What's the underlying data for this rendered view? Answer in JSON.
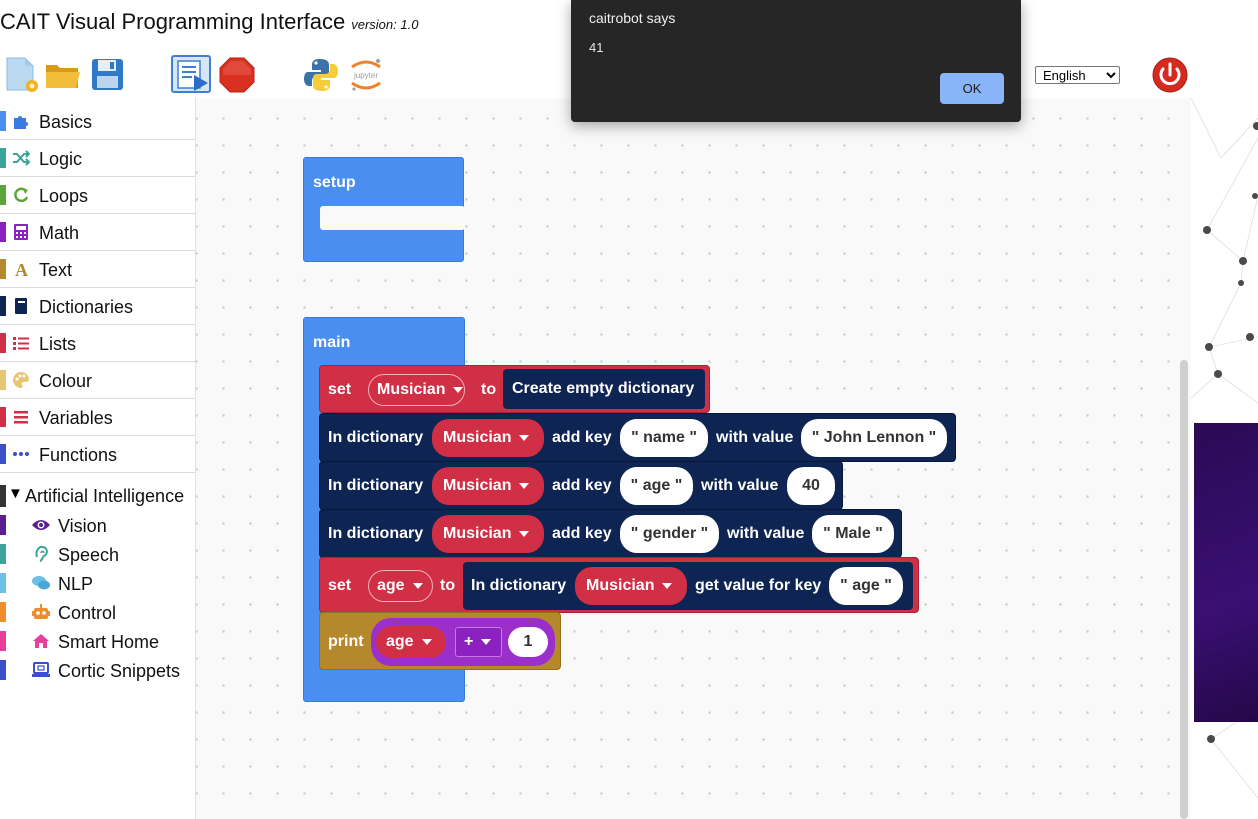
{
  "app": {
    "title": "CAIT Visual Programming Interface",
    "version": "version: 1.0"
  },
  "toolbar": {
    "buttons": [
      "new-file-icon",
      "open-folder-icon",
      "save-icon",
      "run-icon",
      "stop-icon",
      "python-icon",
      "jupyter-icon",
      "power-icon"
    ],
    "jupyter_text": "jupyter",
    "language": "English"
  },
  "sidebar": {
    "categories": [
      {
        "label": "Basics",
        "color": "#4a8ef0",
        "icon": "puzzle-icon"
      },
      {
        "label": "Logic",
        "color": "#3aa39a",
        "icon": "shuffle-icon"
      },
      {
        "label": "Loops",
        "color": "#5ba53a",
        "icon": "loop-icon"
      },
      {
        "label": "Math",
        "color": "#8b22c0",
        "icon": "calculator-icon"
      },
      {
        "label": "Text",
        "color": "#b6882c",
        "icon": "text-icon"
      },
      {
        "label": "Dictionaries",
        "color": "#0e2452",
        "icon": "book-icon"
      },
      {
        "label": "Lists",
        "color": "#d02f45",
        "icon": "list-icon"
      },
      {
        "label": "Colour",
        "color": "#e8c572",
        "icon": "palette-icon"
      },
      {
        "label": "Variables",
        "color": "#d02f45",
        "icon": "variables-icon"
      },
      {
        "label": "Functions",
        "color": "#3b4fc9",
        "icon": "ellipsis-icon"
      }
    ],
    "ai_group": {
      "arrow": "▼",
      "label": "Artificial Intelligence"
    },
    "ai_items": [
      {
        "label": "Vision",
        "color": "#5c1e8f",
        "icon": "eye-icon"
      },
      {
        "label": "Speech",
        "color": "#3aa39a",
        "icon": "ear-icon"
      },
      {
        "label": "NLP",
        "color": "#6bc1e6",
        "icon": "chat-icon"
      },
      {
        "label": "Control",
        "color": "#ef8d2c",
        "icon": "robot-icon"
      },
      {
        "label": "Smart Home",
        "color": "#e83f9c",
        "icon": "home-icon"
      },
      {
        "label": "Cortic Snippets",
        "color": "#3b4fc9",
        "icon": "laptop-icon"
      }
    ]
  },
  "blocks": {
    "setup_label": "setup",
    "main_label": "main",
    "row1": {
      "set": "set",
      "var": "Musician",
      "to": "to",
      "value": "Create empty dictionary"
    },
    "row2": {
      "in": "In dictionary",
      "dict": "Musician",
      "add": "add key",
      "key": "\" name \"",
      "with": "with value",
      "value": "\" John Lennon \""
    },
    "row3": {
      "in": "In dictionary",
      "dict": "Musician",
      "add": "add key",
      "key": "\" age \"",
      "with": "with value",
      "value": "40"
    },
    "row4": {
      "in": "In dictionary",
      "dict": "Musician",
      "add": "add key",
      "key": "\" gender \"",
      "with": "with value",
      "value": "\" Male \""
    },
    "row5": {
      "set": "set",
      "var": "age",
      "to": "to",
      "in": "In dictionary",
      "dict": "Musician",
      "get": "get value for key",
      "key": "\" age \""
    },
    "row6": {
      "print": "print",
      "var": "age",
      "op": "+",
      "num": "1"
    }
  },
  "dialog": {
    "title": "caitrobot says",
    "message": "41",
    "ok": "OK"
  }
}
